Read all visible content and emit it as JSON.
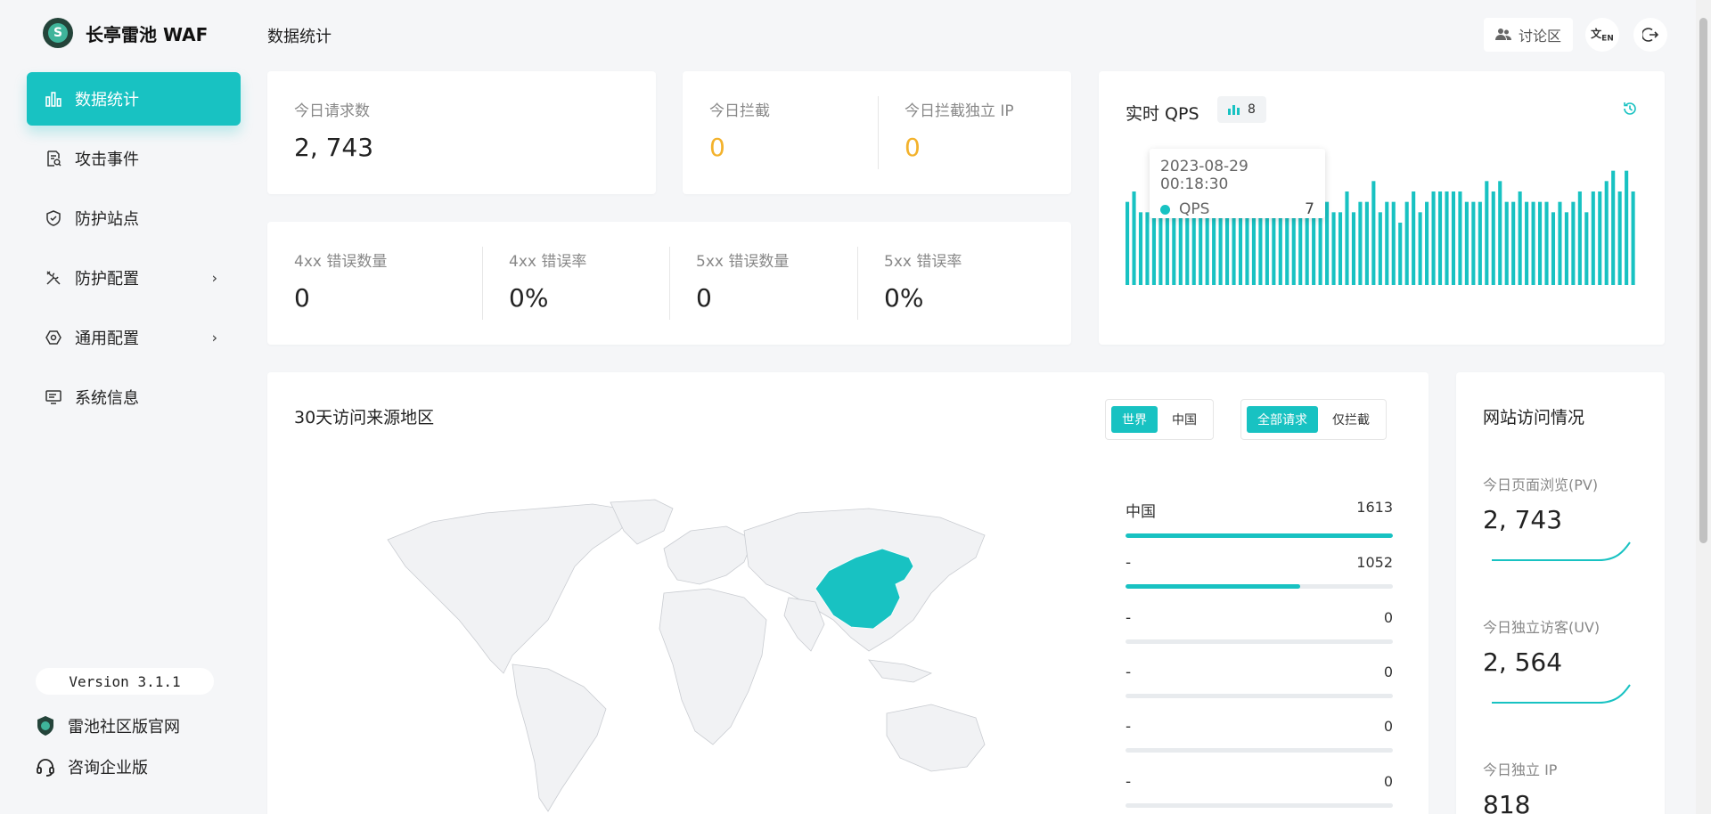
{
  "app": {
    "name": "长亭雷池 WAF",
    "version": "Version 3.1.1"
  },
  "colors": {
    "accent": "#18c2c2",
    "warning": "#f3b22c"
  },
  "sidebar": {
    "items": [
      {
        "label": "数据统计",
        "icon": "bar-chart-icon",
        "active": true
      },
      {
        "label": "攻击事件",
        "icon": "document-search-icon"
      },
      {
        "label": "防护站点",
        "icon": "shield-icon"
      },
      {
        "label": "防护配置",
        "icon": "tools-icon",
        "has_submenu": true
      },
      {
        "label": "通用配置",
        "icon": "gear-icon",
        "has_submenu": true
      },
      {
        "label": "系统信息",
        "icon": "monitor-icon"
      }
    ],
    "links": [
      {
        "label": "雷池社区版官网",
        "icon": "shield-logo-icon"
      },
      {
        "label": "咨询企业版",
        "icon": "headset-icon"
      }
    ]
  },
  "header": {
    "title": "数据统计",
    "forum": "讨论区",
    "lang_icon": "language-icon",
    "lang_label": "EN",
    "logout_icon": "logout-icon"
  },
  "stats": {
    "requests": {
      "label": "今日请求数",
      "value": "2, 743"
    },
    "blocked": {
      "label": "今日拦截",
      "value": "0"
    },
    "blocked_ip": {
      "label": "今日拦截独立 IP",
      "value": "0"
    },
    "errors": [
      {
        "label": "4xx 错误数量",
        "value": "0"
      },
      {
        "label": "4xx 错误率",
        "value": "0%"
      },
      {
        "label": "5xx 错误数量",
        "value": "0"
      },
      {
        "label": "5xx 错误率",
        "value": "0%"
      }
    ]
  },
  "qps": {
    "title": "实时 QPS",
    "current": "8",
    "tooltip": {
      "time": "2023-08-29 00:18:30",
      "series": "QPS",
      "value": "7"
    }
  },
  "chart_data": {
    "type": "bar",
    "series": [
      {
        "name": "QPS",
        "values": [
          8,
          9,
          7,
          7,
          7,
          7,
          7,
          7,
          7,
          7,
          7,
          7,
          7,
          7,
          7,
          7,
          7,
          7,
          7,
          7,
          7,
          7,
          7,
          7,
          7,
          7,
          7,
          7,
          7,
          7,
          8,
          7,
          7,
          9,
          7,
          8,
          8,
          10,
          7,
          8,
          8,
          6,
          8,
          9,
          7,
          8,
          9,
          9,
          9,
          9,
          9,
          8,
          8,
          8,
          10,
          9,
          10,
          8,
          8,
          9,
          8,
          8,
          8,
          8,
          7,
          8,
          7,
          8,
          9,
          7,
          9,
          9,
          10,
          11,
          9,
          11,
          9
        ]
      }
    ],
    "ylim": [
      0,
      12
    ]
  },
  "regions": {
    "title": "30天访问来源地区",
    "scope_tabs": [
      "世界",
      "中国"
    ],
    "filter_tabs": [
      "全部请求",
      "仅拦截"
    ],
    "rows": [
      {
        "name": "中国",
        "value": "1613",
        "ratio": 1.0
      },
      {
        "name": "-",
        "value": "1052",
        "ratio": 0.652
      },
      {
        "name": "-",
        "value": "0",
        "ratio": 0
      },
      {
        "name": "-",
        "value": "0",
        "ratio": 0
      },
      {
        "name": "-",
        "value": "0",
        "ratio": 0
      },
      {
        "name": "-",
        "value": "0",
        "ratio": 0
      }
    ]
  },
  "visits": {
    "title": "网站访问情况",
    "pv": {
      "label": "今日页面浏览(PV)",
      "value": "2, 743"
    },
    "uv": {
      "label": "今日独立访客(UV)",
      "value": "2, 564"
    },
    "ip": {
      "label": "今日独立 IP",
      "value": "818"
    }
  }
}
